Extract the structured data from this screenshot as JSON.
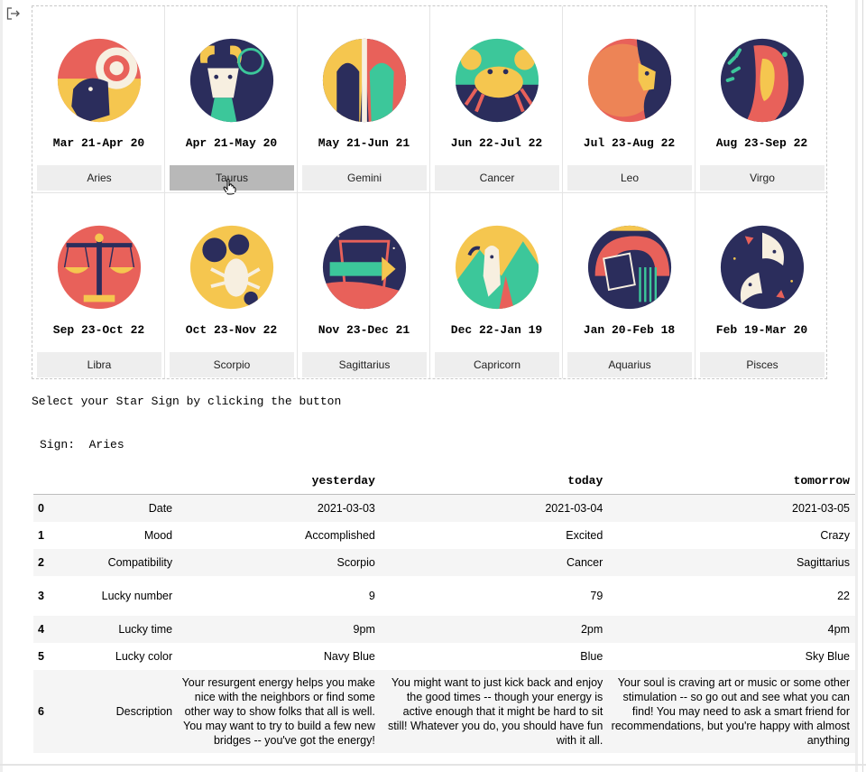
{
  "page": {
    "output_icon": "output-arrow-icon",
    "instruction": "Select your Star Sign by clicking the button",
    "sign_label": "Sign:",
    "sign_value": "Aries"
  },
  "signs": [
    {
      "name": "Aries",
      "dates": "Mar 21-Apr 20",
      "icon": "aries-ram-icon"
    },
    {
      "name": "Taurus",
      "dates": "Apr 21-May 20",
      "icon": "taurus-bull-icon"
    },
    {
      "name": "Gemini",
      "dates": "May 21-Jun 21",
      "icon": "gemini-twins-icon"
    },
    {
      "name": "Cancer",
      "dates": "Jun 22-Jul 22",
      "icon": "cancer-crab-icon"
    },
    {
      "name": "Leo",
      "dates": "Jul 23-Aug 22",
      "icon": "leo-lion-icon"
    },
    {
      "name": "Virgo",
      "dates": "Aug 23-Sep 22",
      "icon": "virgo-maiden-icon"
    },
    {
      "name": "Libra",
      "dates": "Sep 23-Oct 22",
      "icon": "libra-scales-icon"
    },
    {
      "name": "Scorpio",
      "dates": "Oct 23-Nov 22",
      "icon": "scorpio-scorpion-icon"
    },
    {
      "name": "Sagittarius",
      "dates": "Nov 23-Dec 21",
      "icon": "sagittarius-arrow-icon"
    },
    {
      "name": "Capricorn",
      "dates": "Dec 22-Jan 19",
      "icon": "capricorn-goat-icon"
    },
    {
      "name": "Aquarius",
      "dates": "Jan 20-Feb 18",
      "icon": "aquarius-water-icon"
    },
    {
      "name": "Pisces",
      "dates": "Feb 19-Mar 20",
      "icon": "pisces-fish-icon"
    }
  ],
  "hovered_sign": "Taurus",
  "table": {
    "columns": [
      "yesterday",
      "today",
      "tomorrow"
    ],
    "rows": [
      {
        "index": "0",
        "label": "Date",
        "values": [
          "2021-03-03",
          "2021-03-04",
          "2021-03-05"
        ]
      },
      {
        "index": "1",
        "label": "Mood",
        "values": [
          "Accomplished",
          "Excited",
          "Crazy"
        ]
      },
      {
        "index": "2",
        "label": "Compatibility",
        "values": [
          "Scorpio",
          "Cancer",
          "Sagittarius"
        ]
      },
      {
        "index": "3",
        "label": "Lucky number",
        "values": [
          "9",
          "79",
          "22"
        ]
      },
      {
        "index": "4",
        "label": "Lucky time",
        "values": [
          "9pm",
          "2pm",
          "4pm"
        ]
      },
      {
        "index": "5",
        "label": "Lucky color",
        "values": [
          "Navy Blue",
          "Blue",
          "Sky Blue"
        ]
      },
      {
        "index": "6",
        "label": "Description",
        "values": [
          "Your resurgent energy helps you make nice with the neighbors or find some other way to show folks that all is well. You may want to try to build a few new bridges -- you've got the energy!",
          "You might want to just kick back and enjoy the good times -- though your energy is active enough that it might be hard to sit still! Whatever you do, you should have fun with it all.",
          "Your soul is craving art or music or some other stimulation -- so go out and see what you can find! You may need to ask a smart friend for recommendations, but you're happy with almost anything"
        ]
      }
    ]
  },
  "colors": {
    "navy": "#2b2d5c",
    "coral": "#e8615a",
    "yellow": "#f5c64f",
    "teal": "#3cc79a",
    "cream": "#f7efe0",
    "button_bg": "#eeeeee",
    "button_active": "#b8b8b8"
  }
}
